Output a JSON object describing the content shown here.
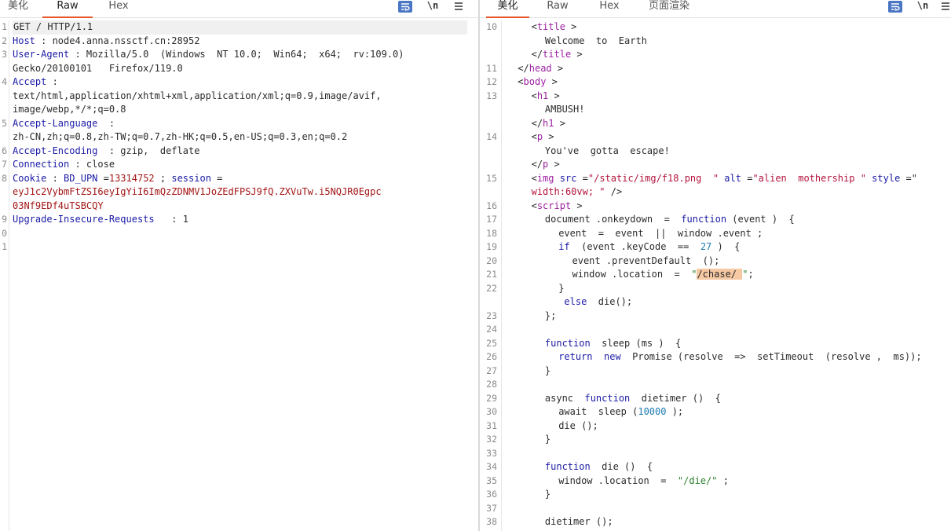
{
  "left_pane": {
    "tabs": [
      "美化",
      "Raw",
      "Hex"
    ],
    "active_tab": "Raw",
    "tools": {
      "newline_label": "\\n"
    },
    "lines": [
      {
        "n": "1",
        "segs": [
          [
            "GET / HTTP/1.1",
            ""
          ]
        ]
      },
      {
        "n": "2",
        "segs": [
          [
            "Host",
            "k"
          ],
          [
            " : node4.anna.nssctf.cn:28952",
            ""
          ]
        ]
      },
      {
        "n": "3",
        "segs": [
          [
            "User-Agent",
            "k"
          ],
          [
            " : Mozilla/5.0  (Windows  NT 10.0;  Win64;  x64;  rv:109.0)",
            ""
          ]
        ]
      },
      {
        "n": "",
        "segs": [
          [
            "Gecko/20100101   Firefox/119.0",
            ""
          ]
        ]
      },
      {
        "n": "4",
        "segs": [
          [
            "Accept",
            "k"
          ],
          [
            " :",
            ""
          ]
        ]
      },
      {
        "n": "",
        "segs": [
          [
            "text/html,application/xhtml+xml,application/xml;q=0.9,image/avif,",
            ""
          ]
        ]
      },
      {
        "n": "",
        "segs": [
          [
            "image/webp,*/*;q=0.8",
            ""
          ]
        ]
      },
      {
        "n": "5",
        "segs": [
          [
            "Accept-Language",
            "k"
          ],
          [
            "  :",
            ""
          ]
        ]
      },
      {
        "n": "",
        "segs": [
          [
            "zh-CN,zh;q=0.8,zh-TW;q=0.7,zh-HK;q=0.5,en-US;q=0.3,en;q=0.2",
            ""
          ]
        ]
      },
      {
        "n": "6",
        "segs": [
          [
            "Accept-Encoding",
            "k"
          ],
          [
            "  : gzip,  deflate",
            ""
          ]
        ]
      },
      {
        "n": "7",
        "segs": [
          [
            "Connection",
            "k"
          ],
          [
            " : close",
            ""
          ]
        ]
      },
      {
        "n": "8",
        "segs": [
          [
            "Cookie",
            "k"
          ],
          [
            " : ",
            ""
          ],
          [
            "BD_UPN",
            "k"
          ],
          [
            " =",
            ""
          ],
          [
            "13314752",
            "rv"
          ],
          [
            " ; ",
            ""
          ],
          [
            "session",
            "k"
          ],
          [
            " =",
            ""
          ]
        ]
      },
      {
        "n": "",
        "segs": [
          [
            "eyJ1c2VybmFtZSI6eyIgYiI6ImQzZDNMV1JoZEdFPSJ9fQ.ZXVuTw.i5NQJR0Egpc",
            "rv"
          ]
        ]
      },
      {
        "n": "",
        "segs": [
          [
            "03Nf9EDf4uTSBCQY",
            "rv"
          ]
        ]
      },
      {
        "n": "9",
        "segs": [
          [
            "Upgrade-Insecure-Requests",
            "k"
          ],
          [
            "   : 1",
            ""
          ]
        ]
      },
      {
        "n": "0",
        "segs": []
      },
      {
        "n": "1",
        "segs": []
      }
    ]
  },
  "right_pane": {
    "tabs": [
      "美化",
      "Raw",
      "Hex",
      "页面渲染"
    ],
    "active_tab": "美化",
    "tools": {
      "newline_label": "\\n"
    },
    "lines": [
      {
        "n": "10",
        "ind": 2,
        "segs": [
          [
            "<",
            ""
          ],
          [
            "title",
            "tag"
          ],
          [
            " >",
            ""
          ]
        ]
      },
      {
        "n": "",
        "ind": 3,
        "segs": [
          [
            "Welcome  to  Earth",
            ""
          ]
        ]
      },
      {
        "n": "",
        "ind": 2,
        "segs": [
          [
            "</",
            ""
          ],
          [
            "title",
            "tag"
          ],
          [
            " >",
            ""
          ]
        ]
      },
      {
        "n": "11",
        "ind": 1,
        "segs": [
          [
            "</",
            ""
          ],
          [
            "head",
            "tag"
          ],
          [
            " >",
            ""
          ]
        ]
      },
      {
        "n": "12",
        "ind": 1,
        "segs": [
          [
            "<",
            ""
          ],
          [
            "body",
            "tag"
          ],
          [
            " >",
            ""
          ]
        ]
      },
      {
        "n": "13",
        "ind": 2,
        "segs": [
          [
            "<",
            ""
          ],
          [
            "h1",
            "tag"
          ],
          [
            " >",
            ""
          ]
        ]
      },
      {
        "n": "",
        "ind": 3,
        "segs": [
          [
            "AMBUSH!",
            ""
          ]
        ]
      },
      {
        "n": "",
        "ind": 2,
        "segs": [
          [
            "</",
            ""
          ],
          [
            "h1",
            "tag"
          ],
          [
            " >",
            ""
          ]
        ]
      },
      {
        "n": "14",
        "ind": 2,
        "segs": [
          [
            "<",
            ""
          ],
          [
            "p",
            "tag"
          ],
          [
            " >",
            ""
          ]
        ]
      },
      {
        "n": "",
        "ind": 3,
        "segs": [
          [
            "You've  gotta  escape!",
            ""
          ]
        ]
      },
      {
        "n": "",
        "ind": 2,
        "segs": [
          [
            "</",
            ""
          ],
          [
            "p",
            "tag"
          ],
          [
            " >",
            ""
          ]
        ]
      },
      {
        "n": "15",
        "ind": 2,
        "segs": [
          [
            "<",
            ""
          ],
          [
            "img",
            "tag"
          ],
          [
            " ",
            ""
          ],
          [
            "src",
            "attr"
          ],
          [
            " =",
            ""
          ],
          [
            "\"/static/img/f18.png  \"",
            "str"
          ],
          [
            " ",
            ""
          ],
          [
            "alt",
            "attr"
          ],
          [
            " =",
            ""
          ],
          [
            "\"alien  mothership \"",
            "str"
          ],
          [
            " ",
            ""
          ],
          [
            "style",
            "attr"
          ],
          [
            " =\"",
            ""
          ]
        ]
      },
      {
        "n": "",
        "ind": 2,
        "segs": [
          [
            "width:60vw; \"",
            "str"
          ],
          [
            " />",
            ""
          ]
        ]
      },
      {
        "n": "16",
        "ind": 2,
        "segs": [
          [
            "<",
            ""
          ],
          [
            "script",
            "tag"
          ],
          [
            " >",
            ""
          ]
        ]
      },
      {
        "n": "17",
        "ind": 3,
        "segs": [
          [
            "document .onkeydown  =  ",
            ""
          ],
          [
            "function",
            "kw"
          ],
          [
            " (event )  {",
            ""
          ]
        ]
      },
      {
        "n": "18",
        "ind": 4,
        "segs": [
          [
            "event  =  event  ||  window .event ;",
            ""
          ]
        ]
      },
      {
        "n": "19",
        "ind": 4,
        "segs": [
          [
            "if",
            "kw"
          ],
          [
            "  (event .keyCode  ==  ",
            ""
          ],
          [
            "27",
            "num"
          ],
          [
            " )  {",
            ""
          ]
        ]
      },
      {
        "n": "20",
        "ind": 5,
        "segs": [
          [
            "event .preventDefault  ();",
            ""
          ]
        ]
      },
      {
        "n": "21",
        "ind": 5,
        "segs": [
          [
            "window .location  =  ",
            ""
          ],
          [
            "\"",
            "strg"
          ],
          [
            "/chase/ ",
            "hl"
          ],
          [
            "\"",
            "strg"
          ],
          [
            ";",
            ""
          ]
        ]
      },
      {
        "n": "22",
        "ind": 4,
        "segs": [
          [
            "}",
            ""
          ]
        ]
      },
      {
        "n": "",
        "ind": 4,
        "segs": [
          [
            " ",
            ""
          ],
          [
            "else",
            "kw"
          ],
          [
            "  die();",
            ""
          ]
        ]
      },
      {
        "n": "23",
        "ind": 3,
        "segs": [
          [
            "};",
            ""
          ]
        ]
      },
      {
        "n": "24",
        "ind": 0,
        "segs": []
      },
      {
        "n": "25",
        "ind": 3,
        "segs": [
          [
            "function",
            "kw"
          ],
          [
            "  sleep (ms )  {",
            ""
          ]
        ]
      },
      {
        "n": "26",
        "ind": 4,
        "segs": [
          [
            "return",
            "kw"
          ],
          [
            "  ",
            ""
          ],
          [
            "new",
            "kw"
          ],
          [
            "  Promise (resolve  =>  setTimeout  (resolve ,  ms));",
            ""
          ]
        ]
      },
      {
        "n": "27",
        "ind": 3,
        "segs": [
          [
            "}",
            ""
          ]
        ]
      },
      {
        "n": "28",
        "ind": 0,
        "segs": []
      },
      {
        "n": "29",
        "ind": 3,
        "segs": [
          [
            "async  ",
            ""
          ],
          [
            "function",
            "kw"
          ],
          [
            "  dietimer ()  {",
            ""
          ]
        ]
      },
      {
        "n": "30",
        "ind": 4,
        "segs": [
          [
            "await  sleep (",
            ""
          ],
          [
            "10000",
            "num"
          ],
          [
            " );",
            ""
          ]
        ]
      },
      {
        "n": "31",
        "ind": 4,
        "segs": [
          [
            "die ();",
            ""
          ]
        ]
      },
      {
        "n": "32",
        "ind": 3,
        "segs": [
          [
            "}",
            ""
          ]
        ]
      },
      {
        "n": "33",
        "ind": 0,
        "segs": []
      },
      {
        "n": "34",
        "ind": 3,
        "segs": [
          [
            "function",
            "kw"
          ],
          [
            "  die ()  {",
            ""
          ]
        ]
      },
      {
        "n": "35",
        "ind": 4,
        "segs": [
          [
            "window .location  =  ",
            ""
          ],
          [
            "\"/die/\"",
            "strg"
          ],
          [
            " ;",
            ""
          ]
        ]
      },
      {
        "n": "36",
        "ind": 3,
        "segs": [
          [
            "}",
            ""
          ]
        ]
      },
      {
        "n": "37",
        "ind": 0,
        "segs": []
      },
      {
        "n": "38",
        "ind": 3,
        "segs": [
          [
            "dietimer ();",
            ""
          ]
        ]
      }
    ]
  }
}
